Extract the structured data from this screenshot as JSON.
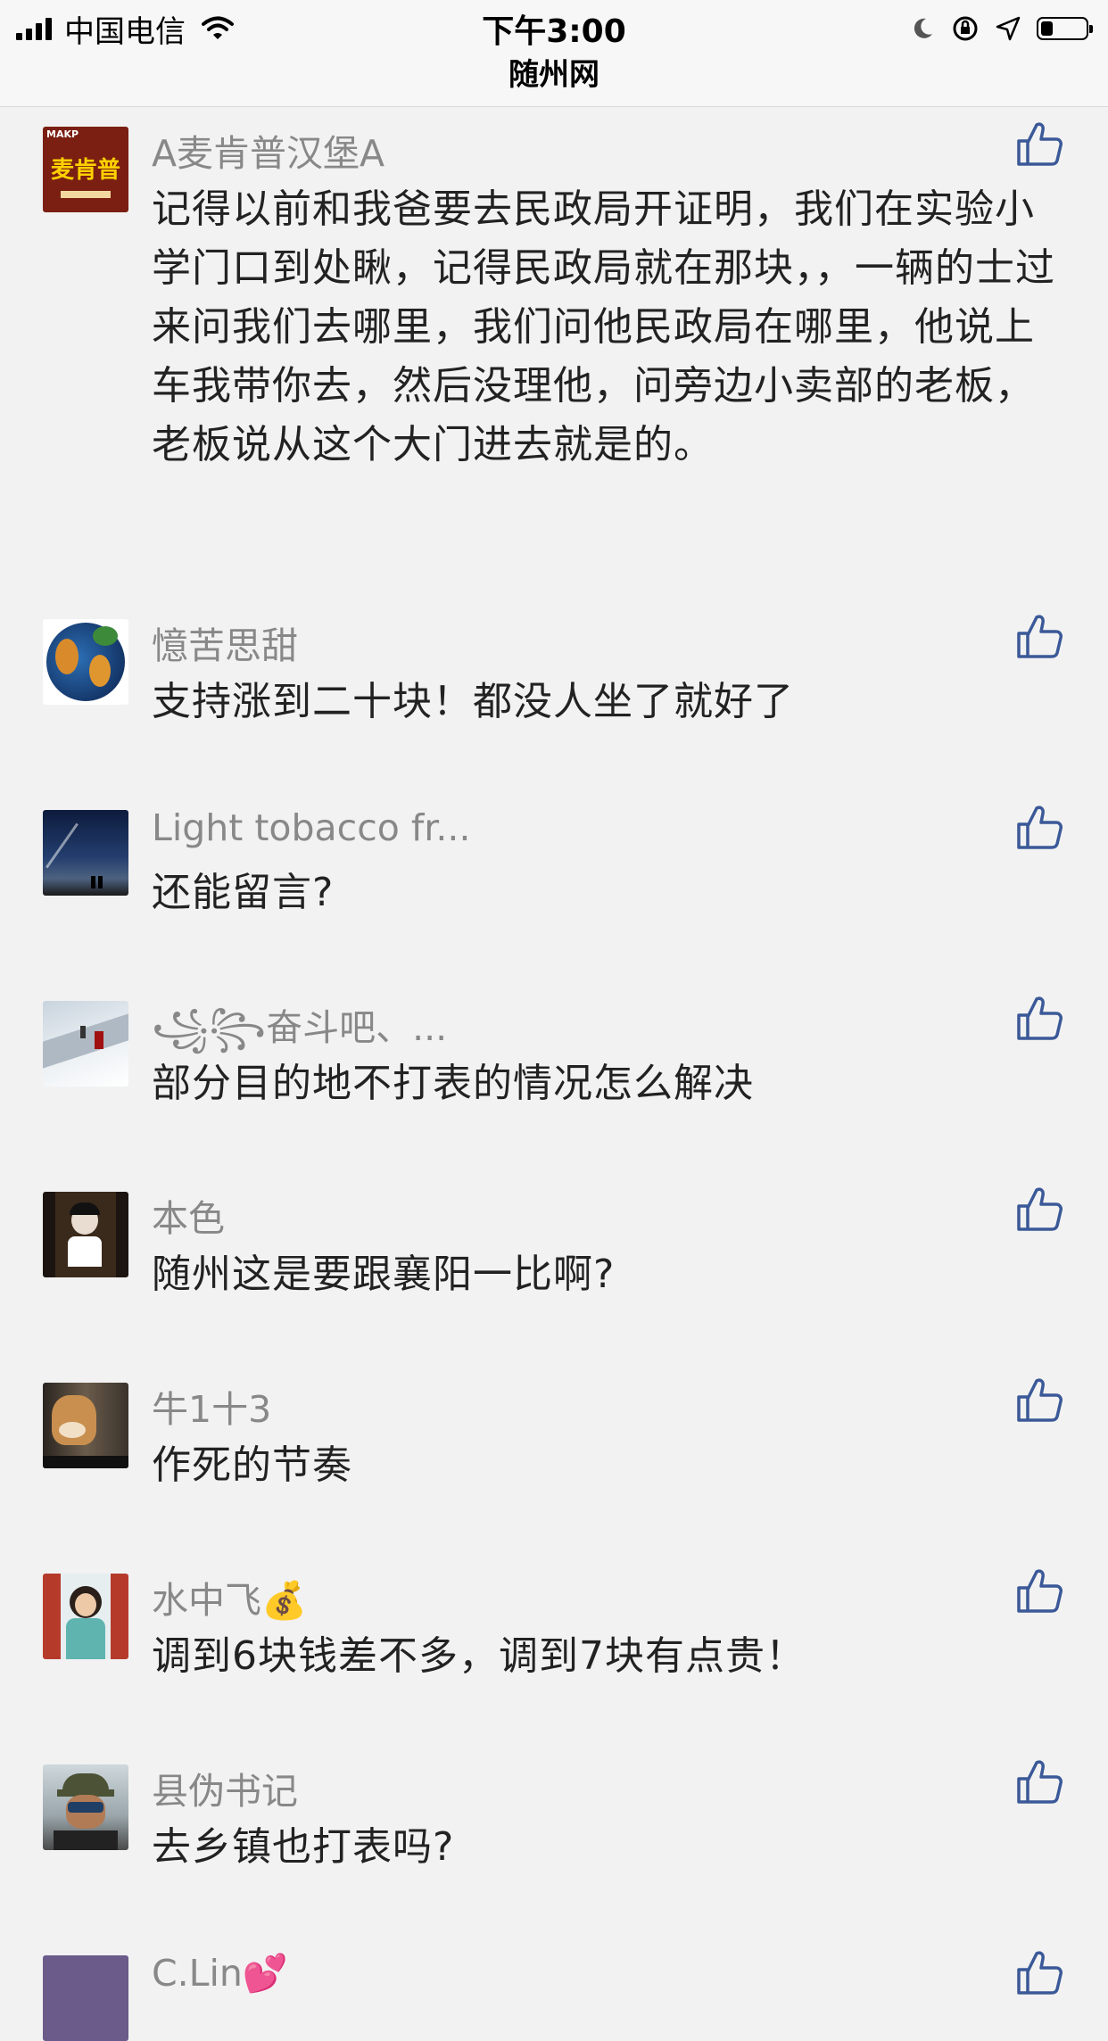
{
  "status": {
    "carrier": "中国电信",
    "time": "下午3:00",
    "page_title": "随州网",
    "battery_level": 0.28
  },
  "comments": [
    {
      "name": "A麦肯普汉堡A",
      "text": "记得以前和我爸要去民政局开证明，我们在实验小学门口到处瞅，记得民政局就在那块，，一辆的士过来问我们去哪里，我们问他民政局在哪里，他说上车我带你去，然后没理他，问旁边小卖部的老板，老板说从这个大门进去就是的。",
      "avatar_label": "麦肯普",
      "avatar_small": "MAKP"
    },
    {
      "name": "憶苦思甜",
      "text": "支持涨到二十块！都没人坐了就好了"
    },
    {
      "name": "Light tobacco fr...",
      "text": "还能留言?"
    },
    {
      "name": "꧁꧂奋斗吧、...",
      "text": "部分目的地不打表的情况怎么解决"
    },
    {
      "name": "本色",
      "text": "随州这是要跟襄阳一比啊?"
    },
    {
      "name": "牛1十3",
      "text": "作死的节奏"
    },
    {
      "name": "水中飞💰",
      "text": "调到6块钱差不多，调到7块有点贵！"
    },
    {
      "name": "县伪书记",
      "text": "去乡镇也打表吗?"
    },
    {
      "name": "C.Lin💕",
      "text": ""
    }
  ]
}
